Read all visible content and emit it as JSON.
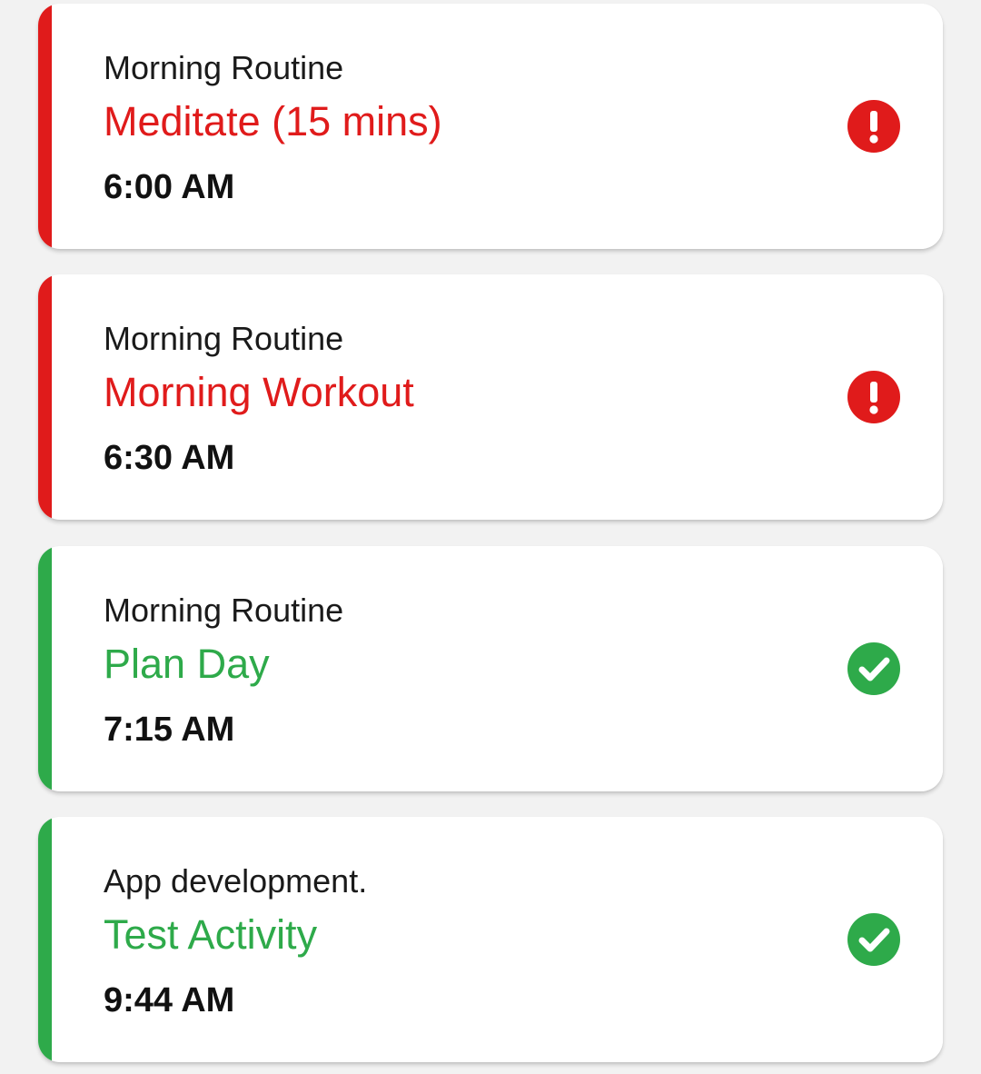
{
  "colors": {
    "overdue": "#e01b1b",
    "done": "#2eaa4a",
    "background": "#f2f2f2"
  },
  "tasks": [
    {
      "group": "Morning Routine",
      "title": "Meditate (15 mins)",
      "time": "6:00 AM",
      "status": "overdue",
      "icon": "alert-icon"
    },
    {
      "group": "Morning Routine",
      "title": "Morning Workout",
      "time": "6:30 AM",
      "status": "overdue",
      "icon": "alert-icon"
    },
    {
      "group": "Morning Routine",
      "title": "Plan Day",
      "time": "7:15 AM",
      "status": "done",
      "icon": "check-circle-icon"
    },
    {
      "group": "App development.",
      "title": "Test Activity",
      "time": "9:44 AM",
      "status": "done",
      "icon": "check-circle-icon"
    }
  ]
}
